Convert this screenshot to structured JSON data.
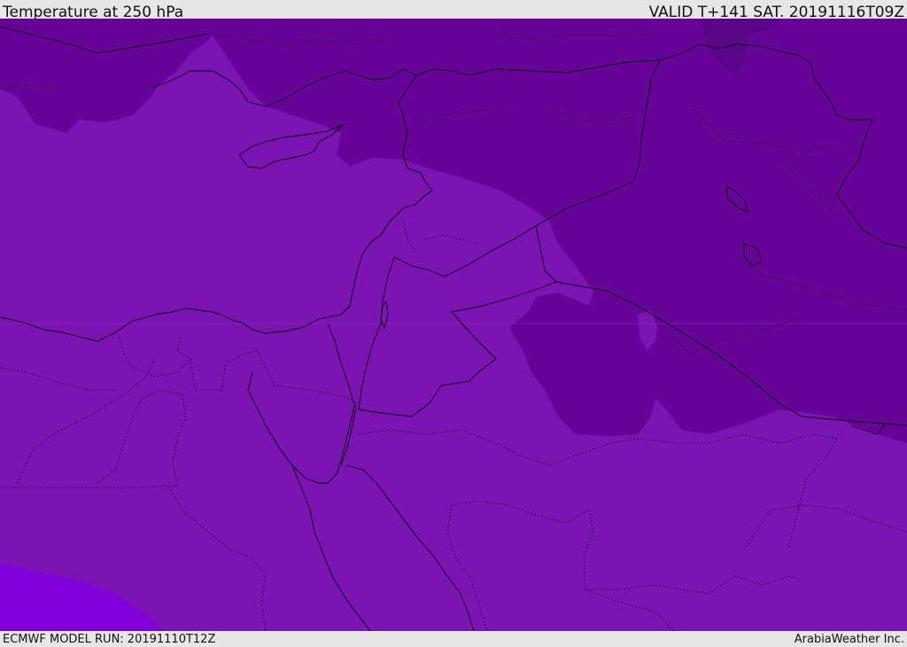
{
  "header": {
    "title": "Temperature at 250 hPa",
    "valid": "VALID T+141 SAT. 20191116T09Z"
  },
  "footer": {
    "model_run": "ECMWF MODEL RUN: 20191110T12Z",
    "credit": "ArabiaWeather Inc."
  },
  "colors": {
    "warm_band": "#7c14b4",
    "cold_band": "#68039a",
    "coldest_band": "#5a0488",
    "warmest_band": "#8200dc",
    "border": "#000000",
    "bar_background": "#e6e6e6"
  }
}
